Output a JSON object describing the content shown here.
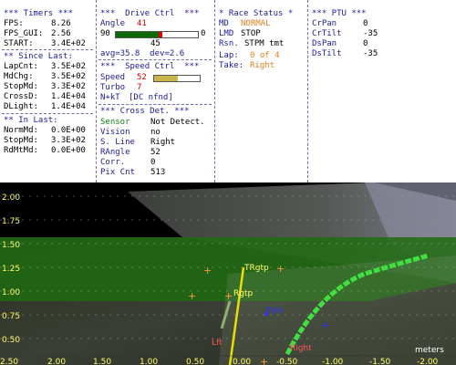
{
  "timers": {
    "title": "*** Timers ***",
    "fps_label": "FPS:",
    "fps": "8.26",
    "fps_gui_label": "FPS_GUI:",
    "fps_gui": "2.56",
    "start_label": "START:",
    "start": "3.4E+02",
    "since_last_title": "** Since Last:",
    "since_last": [
      {
        "label": "LapCnt:",
        "value": "3.5E+02"
      },
      {
        "label": "MdChg:",
        "value": "3.5E+02"
      },
      {
        "label": "StopMd:",
        "value": "3.3E+02"
      },
      {
        "label": "CrossD:",
        "value": "1.4E+04"
      },
      {
        "label": "DLight:",
        "value": "1.4E+04"
      }
    ],
    "in_last_title": "** In Last:",
    "in_last": [
      {
        "label": "NormMd:",
        "value": "0.0E+00"
      },
      {
        "label": "StopMd:",
        "value": "3.3E+02"
      },
      {
        "label": "RdMtMd:",
        "value": "0.0E+00"
      }
    ]
  },
  "drive": {
    "title": "***  Drive Ctrl  ***",
    "angle_label": "Angle",
    "angle": "41",
    "slider_min": "90",
    "slider_max": "0",
    "slider_mid": "45",
    "angle_fraction": 0.54,
    "stats": "avg=35.8  dev=2.6",
    "speed_title": "***  Speed Ctrl  ***",
    "speed_label": "Speed",
    "speed": "52",
    "speed_fraction": 0.52,
    "turbo_label": "Turbo",
    "turbo": "7",
    "nkt_label": "N+kT",
    "nkt": "[DC nfnd]",
    "cross_title": "*** Cross Det. ***",
    "sensor_label": "Sensor",
    "sensor": "Not Detect.",
    "vision_label": "Vision",
    "vision": "no",
    "sline_label": "S. Line",
    "sline": "Right",
    "rangle_label": "RAngle",
    "rangle": "52",
    "corr_label": "Corr.",
    "corr": "0",
    "pix_label": "Pix Cnt",
    "pix": "513"
  },
  "race": {
    "title": "* Race Status *",
    "md_label": "MD",
    "md": "NORMAL",
    "lmd_label": "LMD",
    "lmd": "STOP",
    "rsn_label": "Rsn.",
    "rsn": "STPM tmt",
    "lap_label": "Lap:",
    "lap": "0 of 4",
    "take_label": "Take:",
    "take": "Right"
  },
  "ptu": {
    "title": "*** PTU ***",
    "rows": [
      {
        "label": "CrPan",
        "value": "0"
      },
      {
        "label": "CrTilt",
        "value": "-35"
      },
      {
        "label": "DsPan",
        "value": "0"
      },
      {
        "label": "DsTilt",
        "value": "-35"
      }
    ]
  },
  "view": {
    "y_ticks": [
      "2.00",
      "1.75",
      "1.50",
      "1.25",
      "1.00",
      "0.75",
      "0.50",
      "0.25"
    ],
    "x_ticks": [
      "2.00",
      "1.50",
      "1.00",
      "0.50",
      "0.00",
      "-0.50",
      "-1.00",
      "-1.50",
      "-2.00"
    ],
    "x_ticks_shifted": [
      "2.50"
    ],
    "units": "meters",
    "labels": {
      "trgtp": "TRgtp",
      "rgtp": "Rgtp",
      "left_mark": "Lft",
      "right_mark": "Right",
      "blue_mark": "Rgtp"
    },
    "colors": {
      "overlay_green": "#1f6b10",
      "track_line": "#40e040",
      "target_line": "#e8e000",
      "marker_orange": "#ff9933",
      "axis_label": "#ffff66"
    }
  }
}
